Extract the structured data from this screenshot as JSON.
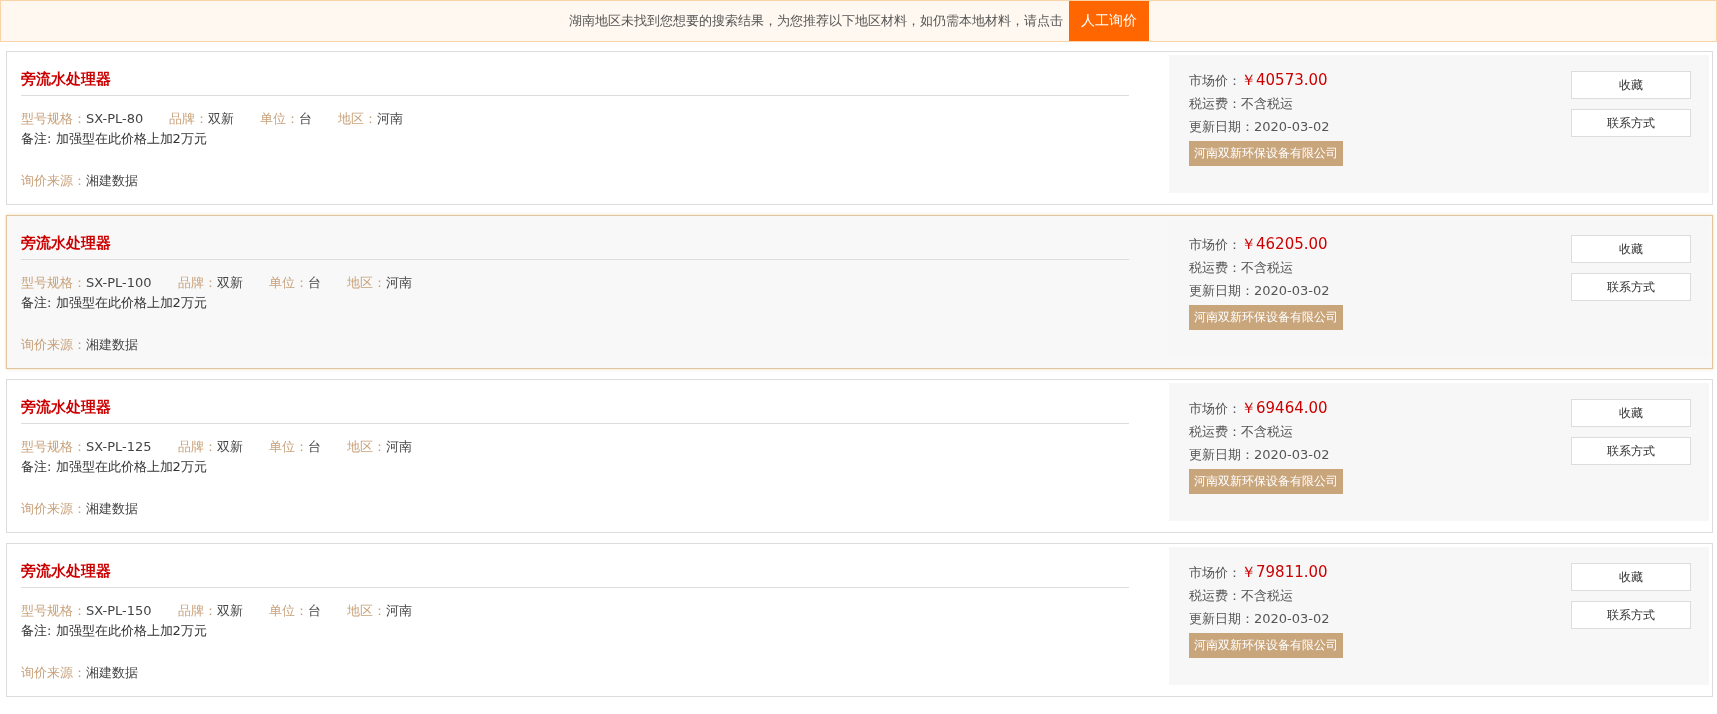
{
  "notice": {
    "text": "湖南地区未找到您想要的搜索结果，为您推荐以下地区材料，如仍需本地材料，请点击",
    "button": "人工询价"
  },
  "products": [
    {
      "selected": false,
      "title": "旁流水处理器",
      "specs": [
        {
          "label": "型号规格：",
          "value": "SX-PL-80"
        },
        {
          "label": "品牌：",
          "value": "双新"
        },
        {
          "label": "单位：",
          "value": "台"
        },
        {
          "label": "地区：",
          "value": "河南"
        }
      ],
      "note": "备注: 加强型在此价格上加2万元",
      "source_label": "询价来源：",
      "source": "湘建数据",
      "price_label": "市场价：",
      "price": "￥40573.00",
      "tax_label": "税运费：",
      "tax": "不含税运",
      "date_label": "更新日期：",
      "date": "2020-03-02",
      "company": "河南双新环保设备有限公司",
      "buttons": [
        "收藏",
        "联系方式"
      ]
    },
    {
      "selected": true,
      "title": "旁流水处理器",
      "specs": [
        {
          "label": "型号规格：",
          "value": "SX-PL-100"
        },
        {
          "label": "品牌：",
          "value": "双新"
        },
        {
          "label": "单位：",
          "value": "台"
        },
        {
          "label": "地区：",
          "value": "河南"
        }
      ],
      "note": "备注: 加强型在此价格上加2万元",
      "source_label": "询价来源：",
      "source": "湘建数据",
      "price_label": "市场价：",
      "price": "￥46205.00",
      "tax_label": "税运费：",
      "tax": "不含税运",
      "date_label": "更新日期：",
      "date": "2020-03-02",
      "company": "河南双新环保设备有限公司",
      "buttons": [
        "收藏",
        "联系方式"
      ]
    },
    {
      "selected": false,
      "title": "旁流水处理器",
      "specs": [
        {
          "label": "型号规格：",
          "value": "SX-PL-125"
        },
        {
          "label": "品牌：",
          "value": "双新"
        },
        {
          "label": "单位：",
          "value": "台"
        },
        {
          "label": "地区：",
          "value": "河南"
        }
      ],
      "note": "备注: 加强型在此价格上加2万元",
      "source_label": "询价来源：",
      "source": "湘建数据",
      "price_label": "市场价：",
      "price": "￥69464.00",
      "tax_label": "税运费：",
      "tax": "不含税运",
      "date_label": "更新日期：",
      "date": "2020-03-02",
      "company": "河南双新环保设备有限公司",
      "buttons": [
        "收藏",
        "联系方式"
      ]
    },
    {
      "selected": false,
      "title": "旁流水处理器",
      "specs": [
        {
          "label": "型号规格：",
          "value": "SX-PL-150"
        },
        {
          "label": "品牌：",
          "value": "双新"
        },
        {
          "label": "单位：",
          "value": "台"
        },
        {
          "label": "地区：",
          "value": "河南"
        }
      ],
      "note": "备注: 加强型在此价格上加2万元",
      "source_label": "询价来源：",
      "source": "湘建数据",
      "price_label": "市场价：",
      "price": "￥79811.00",
      "tax_label": "税运费：",
      "tax": "不含税运",
      "date_label": "更新日期：",
      "date": "2020-03-02",
      "company": "河南双新环保设备有限公司",
      "buttons": [
        "收藏",
        "联系方式"
      ]
    }
  ]
}
